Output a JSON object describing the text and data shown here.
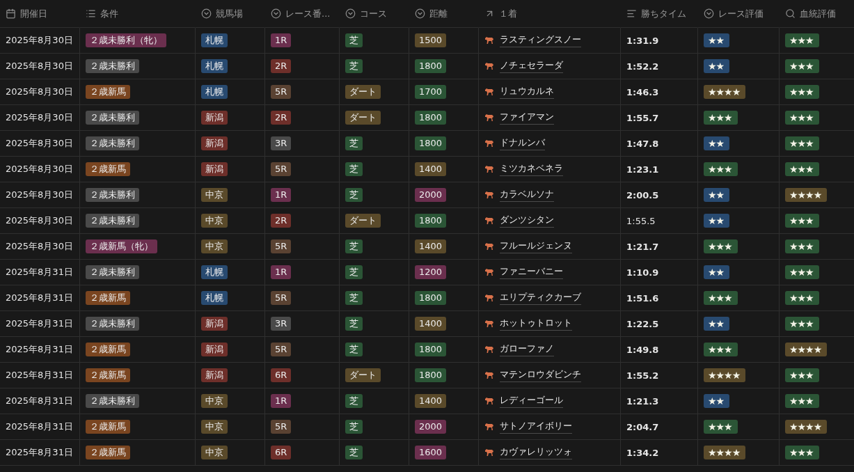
{
  "table": {
    "columns": [
      {
        "label": "開催日",
        "kind": "date"
      },
      {
        "label": "条件",
        "kind": "list"
      },
      {
        "label": "競馬場",
        "kind": "select"
      },
      {
        "label": "レース番...",
        "kind": "select"
      },
      {
        "label": "コース",
        "kind": "select"
      },
      {
        "label": "距離",
        "kind": "select"
      },
      {
        "label": "１着",
        "kind": "relation"
      },
      {
        "label": "勝ちタイム",
        "kind": "text"
      },
      {
        "label": "レース評価",
        "kind": "select"
      },
      {
        "label": "血統評価",
        "kind": "search"
      }
    ],
    "rows": [
      {
        "date": "2025年8月30日",
        "condition": {
          "text": "２歳未勝利（牝）",
          "color": "#6b2f4e"
        },
        "venue": {
          "text": "札幌",
          "color": "#284a70"
        },
        "race": {
          "text": "1R",
          "color": "#6b2f4e"
        },
        "course": {
          "text": "芝",
          "color": "#2b5536"
        },
        "distance": {
          "text": "1500",
          "color": "#5a4a2a"
        },
        "winner": "ラスティングスノー",
        "time": "1:31.9",
        "bold": true,
        "race_eval": {
          "text": "★★",
          "color": "#284a70"
        },
        "blood_eval": {
          "text": "★★★",
          "color": "#2b5536"
        }
      },
      {
        "date": "2025年8月30日",
        "condition": {
          "text": "２歳未勝利",
          "color": "#4a4a4a"
        },
        "venue": {
          "text": "札幌",
          "color": "#284a70"
        },
        "race": {
          "text": "2R",
          "color": "#6e2f2a"
        },
        "course": {
          "text": "芝",
          "color": "#2b5536"
        },
        "distance": {
          "text": "1800",
          "color": "#2b5536"
        },
        "winner": "ノチェセラーダ",
        "time": "1:52.2",
        "bold": true,
        "race_eval": {
          "text": "★★",
          "color": "#284a70"
        },
        "blood_eval": {
          "text": "★★★",
          "color": "#2b5536"
        }
      },
      {
        "date": "2025年8月30日",
        "condition": {
          "text": "２歳新馬",
          "color": "#7a4520"
        },
        "venue": {
          "text": "札幌",
          "color": "#284a70"
        },
        "race": {
          "text": "5R",
          "color": "#5a4232"
        },
        "course": {
          "text": "ダート",
          "color": "#5a4a2a"
        },
        "distance": {
          "text": "1700",
          "color": "#2b5536"
        },
        "winner": "リュウカルネ",
        "time": "1:46.3",
        "bold": true,
        "race_eval": {
          "text": "★★★★",
          "color": "#5a4a2a"
        },
        "blood_eval": {
          "text": "★★★",
          "color": "#2b5536"
        }
      },
      {
        "date": "2025年8月30日",
        "condition": {
          "text": "２歳未勝利",
          "color": "#4a4a4a"
        },
        "venue": {
          "text": "新潟",
          "color": "#6e2f2a"
        },
        "race": {
          "text": "2R",
          "color": "#6e2f2a"
        },
        "course": {
          "text": "ダート",
          "color": "#5a4a2a"
        },
        "distance": {
          "text": "1800",
          "color": "#2b5536"
        },
        "winner": "ファイアマン",
        "time": "1:55.7",
        "bold": true,
        "race_eval": {
          "text": "★★★",
          "color": "#2b5536"
        },
        "blood_eval": {
          "text": "★★★",
          "color": "#2b5536"
        }
      },
      {
        "date": "2025年8月30日",
        "condition": {
          "text": "２歳未勝利",
          "color": "#4a4a4a"
        },
        "venue": {
          "text": "新潟",
          "color": "#6e2f2a"
        },
        "race": {
          "text": "3R",
          "color": "#4a4a4a"
        },
        "course": {
          "text": "芝",
          "color": "#2b5536"
        },
        "distance": {
          "text": "1800",
          "color": "#2b5536"
        },
        "winner": "ドナルンバ",
        "time": "1:47.8",
        "bold": true,
        "race_eval": {
          "text": "★★",
          "color": "#284a70"
        },
        "blood_eval": {
          "text": "★★★",
          "color": "#2b5536"
        }
      },
      {
        "date": "2025年8月30日",
        "condition": {
          "text": "２歳新馬",
          "color": "#7a4520"
        },
        "venue": {
          "text": "新潟",
          "color": "#6e2f2a"
        },
        "race": {
          "text": "5R",
          "color": "#5a4232"
        },
        "course": {
          "text": "芝",
          "color": "#2b5536"
        },
        "distance": {
          "text": "1400",
          "color": "#5a4a2a"
        },
        "winner": "ミツカネベネラ",
        "time": "1:23.1",
        "bold": true,
        "race_eval": {
          "text": "★★★",
          "color": "#2b5536"
        },
        "blood_eval": {
          "text": "★★★",
          "color": "#2b5536"
        }
      },
      {
        "date": "2025年8月30日",
        "condition": {
          "text": "２歳未勝利",
          "color": "#4a4a4a"
        },
        "venue": {
          "text": "中京",
          "color": "#5a4a2a"
        },
        "race": {
          "text": "1R",
          "color": "#6b2f4e"
        },
        "course": {
          "text": "芝",
          "color": "#2b5536"
        },
        "distance": {
          "text": "2000",
          "color": "#6b2f4e"
        },
        "winner": "カラベルソナ",
        "time": "2:00.5",
        "bold": true,
        "race_eval": {
          "text": "★★",
          "color": "#284a70"
        },
        "blood_eval": {
          "text": "★★★★",
          "color": "#5a4a2a"
        }
      },
      {
        "date": "2025年8月30日",
        "condition": {
          "text": "２歳未勝利",
          "color": "#4a4a4a"
        },
        "venue": {
          "text": "中京",
          "color": "#5a4a2a"
        },
        "race": {
          "text": "2R",
          "color": "#6e2f2a"
        },
        "course": {
          "text": "ダート",
          "color": "#5a4a2a"
        },
        "distance": {
          "text": "1800",
          "color": "#2b5536"
        },
        "winner": "ダンツシタン",
        "time": "1:55.5",
        "bold": false,
        "race_eval": {
          "text": "★★",
          "color": "#284a70"
        },
        "blood_eval": {
          "text": "★★★",
          "color": "#2b5536"
        }
      },
      {
        "date": "2025年8月30日",
        "condition": {
          "text": "２歳新馬（牝）",
          "color": "#6b2f4e"
        },
        "venue": {
          "text": "中京",
          "color": "#5a4a2a"
        },
        "race": {
          "text": "5R",
          "color": "#5a4232"
        },
        "course": {
          "text": "芝",
          "color": "#2b5536"
        },
        "distance": {
          "text": "1400",
          "color": "#5a4a2a"
        },
        "winner": "フルールジェンヌ",
        "time": "1:21.7",
        "bold": true,
        "race_eval": {
          "text": "★★★",
          "color": "#2b5536"
        },
        "blood_eval": {
          "text": "★★★",
          "color": "#2b5536"
        }
      },
      {
        "date": "2025年8月31日",
        "condition": {
          "text": "２歳未勝利",
          "color": "#4a4a4a"
        },
        "venue": {
          "text": "札幌",
          "color": "#284a70"
        },
        "race": {
          "text": "1R",
          "color": "#6b2f4e"
        },
        "course": {
          "text": "芝",
          "color": "#2b5536"
        },
        "distance": {
          "text": "1200",
          "color": "#6b2f4e"
        },
        "winner": "ファニーバニー",
        "time": "1:10.9",
        "bold": true,
        "race_eval": {
          "text": "★★",
          "color": "#284a70"
        },
        "blood_eval": {
          "text": "★★★",
          "color": "#2b5536"
        }
      },
      {
        "date": "2025年8月31日",
        "condition": {
          "text": "２歳新馬",
          "color": "#7a4520"
        },
        "venue": {
          "text": "札幌",
          "color": "#284a70"
        },
        "race": {
          "text": "5R",
          "color": "#5a4232"
        },
        "course": {
          "text": "芝",
          "color": "#2b5536"
        },
        "distance": {
          "text": "1800",
          "color": "#2b5536"
        },
        "winner": "エリプティクカーブ",
        "time": "1:51.6",
        "bold": true,
        "race_eval": {
          "text": "★★★",
          "color": "#2b5536"
        },
        "blood_eval": {
          "text": "★★★",
          "color": "#2b5536"
        }
      },
      {
        "date": "2025年8月31日",
        "condition": {
          "text": "２歳未勝利",
          "color": "#4a4a4a"
        },
        "venue": {
          "text": "新潟",
          "color": "#6e2f2a"
        },
        "race": {
          "text": "3R",
          "color": "#4a4a4a"
        },
        "course": {
          "text": "芝",
          "color": "#2b5536"
        },
        "distance": {
          "text": "1400",
          "color": "#5a4a2a"
        },
        "winner": "ホットゥトロット",
        "time": "1:22.5",
        "bold": true,
        "race_eval": {
          "text": "★★",
          "color": "#284a70"
        },
        "blood_eval": {
          "text": "★★★",
          "color": "#2b5536"
        }
      },
      {
        "date": "2025年8月31日",
        "condition": {
          "text": "２歳新馬",
          "color": "#7a4520"
        },
        "venue": {
          "text": "新潟",
          "color": "#6e2f2a"
        },
        "race": {
          "text": "5R",
          "color": "#5a4232"
        },
        "course": {
          "text": "芝",
          "color": "#2b5536"
        },
        "distance": {
          "text": "1800",
          "color": "#2b5536"
        },
        "winner": "ガローファノ",
        "time": "1:49.8",
        "bold": true,
        "race_eval": {
          "text": "★★★",
          "color": "#2b5536"
        },
        "blood_eval": {
          "text": "★★★★",
          "color": "#5a4a2a"
        }
      },
      {
        "date": "2025年8月31日",
        "condition": {
          "text": "２歳新馬",
          "color": "#7a4520"
        },
        "venue": {
          "text": "新潟",
          "color": "#6e2f2a"
        },
        "race": {
          "text": "6R",
          "color": "#6e2f2a"
        },
        "course": {
          "text": "ダート",
          "color": "#5a4a2a"
        },
        "distance": {
          "text": "1800",
          "color": "#2b5536"
        },
        "winner": "マテンロウダビンチ",
        "time": "1:55.2",
        "bold": true,
        "race_eval": {
          "text": "★★★★",
          "color": "#5a4a2a"
        },
        "blood_eval": {
          "text": "★★★",
          "color": "#2b5536"
        }
      },
      {
        "date": "2025年8月31日",
        "condition": {
          "text": "２歳未勝利",
          "color": "#4a4a4a"
        },
        "venue": {
          "text": "中京",
          "color": "#5a4a2a"
        },
        "race": {
          "text": "1R",
          "color": "#6b2f4e"
        },
        "course": {
          "text": "芝",
          "color": "#2b5536"
        },
        "distance": {
          "text": "1400",
          "color": "#5a4a2a"
        },
        "winner": "レディーゴール",
        "time": "1:21.3",
        "bold": true,
        "race_eval": {
          "text": "★★",
          "color": "#284a70"
        },
        "blood_eval": {
          "text": "★★★",
          "color": "#2b5536"
        }
      },
      {
        "date": "2025年8月31日",
        "condition": {
          "text": "２歳新馬",
          "color": "#7a4520"
        },
        "venue": {
          "text": "中京",
          "color": "#5a4a2a"
        },
        "race": {
          "text": "5R",
          "color": "#5a4232"
        },
        "course": {
          "text": "芝",
          "color": "#2b5536"
        },
        "distance": {
          "text": "2000",
          "color": "#6b2f4e"
        },
        "winner": "サトノアイボリー",
        "time": "2:04.7",
        "bold": true,
        "race_eval": {
          "text": "★★★",
          "color": "#2b5536"
        },
        "blood_eval": {
          "text": "★★★★",
          "color": "#5a4a2a"
        }
      },
      {
        "date": "2025年8月31日",
        "condition": {
          "text": "２歳新馬",
          "color": "#7a4520"
        },
        "venue": {
          "text": "中京",
          "color": "#5a4a2a"
        },
        "race": {
          "text": "6R",
          "color": "#6e2f2a"
        },
        "course": {
          "text": "芝",
          "color": "#2b5536"
        },
        "distance": {
          "text": "1600",
          "color": "#6b2f4e"
        },
        "winner": "カヴァレリッツォ",
        "time": "1:34.2",
        "bold": true,
        "race_eval": {
          "text": "★★★★",
          "color": "#5a4a2a"
        },
        "blood_eval": {
          "text": "★★★",
          "color": "#2b5536"
        }
      }
    ]
  }
}
